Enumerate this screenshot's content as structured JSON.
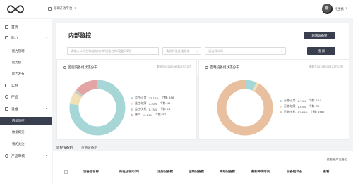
{
  "topbar": {
    "platform_label": "珊瑚开放平台",
    "platform_caret": ">",
    "user_name": "叶生枫",
    "user_caret": "▾"
  },
  "sidebar": {
    "items": [
      {
        "label": "首页",
        "icon": "home-icon"
      },
      {
        "label": "能力",
        "icon": "ability-icon",
        "caret": "down"
      },
      {
        "label": "实例",
        "icon": "instance-icon"
      },
      {
        "label": "产品",
        "icon": "product-icon"
      },
      {
        "label": "设备",
        "icon": "device-icon",
        "caret": "up"
      },
      {
        "label": "产品审核",
        "icon": "review-icon",
        "caret": "down"
      }
    ],
    "ability_subitems": [
      "能力管理",
      "能力接",
      "能力发布"
    ],
    "device_subitems": [
      "内部监控",
      "数据概览",
      "我的关注"
    ]
  },
  "main": {
    "title": "内部监控",
    "new_group_button": "新增设备组",
    "search_placeholder": "请输入公司名称/店铺名称/设备名称/设备SN号",
    "group_select_placeholder": "请选择设备组状态",
    "company_select_placeholder": "请选择公司",
    "search_button": "搜 索"
  },
  "cards": [
    {
      "title": "监控设备组状态分布",
      "updated": "更新于2020年06月21日11时",
      "legend": [
        {
          "label": "监控/正常",
          "pct": "77.14%",
          "count": "个数: 486",
          "color": "#a6d6d6"
        },
        {
          "label": "监控/故障",
          "pct": "7.30%",
          "count": "个数: 46",
          "color": "#f1e0b6"
        },
        {
          "label": "监控/关机",
          "pct": "1.75%",
          "count": "个数: 11",
          "color": "#c9c9c9"
        },
        {
          "label": "撤产",
          "pct": "13.81%",
          "count": "个数: 87",
          "color": "#e3a4a4"
        }
      ]
    },
    {
      "title": "百略设备组状态分布",
      "updated": "更新于2020年06月21日11时",
      "legend": [
        {
          "label": "百略/正常",
          "pct": "6.74%",
          "count": "个数: 124",
          "color": "#a6d6d6"
        },
        {
          "label": "百略/故障",
          "pct": "1.63%",
          "count": "个数: 30",
          "color": "#f1e0b6"
        },
        {
          "label": "百略/关机",
          "pct": "91.63%",
          "count": "个数: 1687",
          "color": "#e8c0a0"
        }
      ]
    }
  ],
  "tabs": [
    {
      "label": "监控设备组",
      "active": true
    },
    {
      "label": "百略设备组",
      "active": false
    }
  ],
  "view_retired_link": "查看撤产设备组",
  "table_headers": [
    "设备组名称",
    "所在店铺/公司",
    "注册设备数",
    "在线设备数",
    "掉线设备数",
    "最新掉线时间",
    "设备组状态",
    "查看"
  ],
  "chart_data": [
    {
      "type": "pie",
      "title": "监控设备组状态分布",
      "categories": [
        "监控/正常",
        "监控/故障",
        "监控/关机",
        "撤产"
      ],
      "values": [
        486,
        46,
        11,
        87
      ],
      "percentages": [
        77.14,
        7.3,
        1.75,
        13.81
      ],
      "colors": [
        "#a6d6d6",
        "#f1e0b6",
        "#c9c9c9",
        "#e3a4a4"
      ]
    },
    {
      "type": "pie",
      "title": "百略设备组状态分布",
      "categories": [
        "百略/正常",
        "百略/故障",
        "百略/关机"
      ],
      "values": [
        124,
        30,
        1687
      ],
      "percentages": [
        6.74,
        1.63,
        91.63
      ],
      "colors": [
        "#a6d6d6",
        "#f1e0b6",
        "#e8c0a0"
      ]
    }
  ]
}
